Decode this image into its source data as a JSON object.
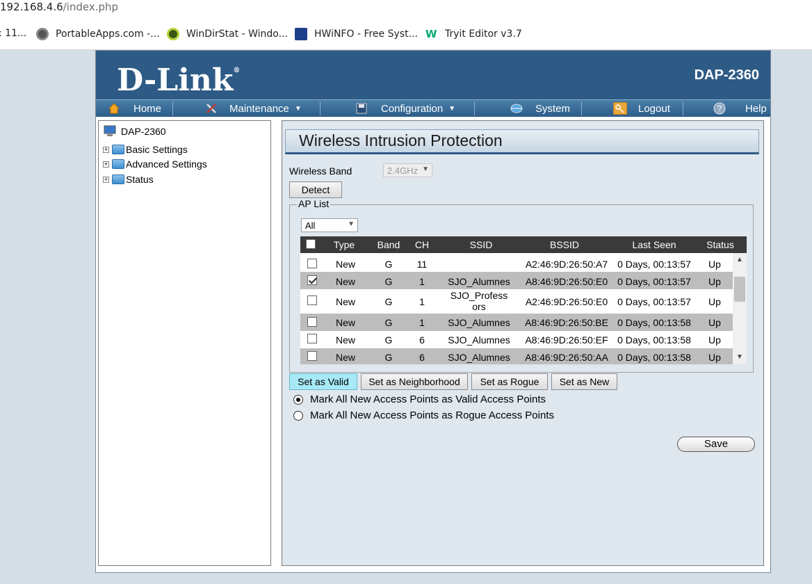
{
  "browser": {
    "url_host": "192.168.4.6",
    "url_path": "/index.php",
    "bookmarks": [
      {
        "label": ": 11...",
        "icon": "page-icon"
      },
      {
        "label": "PortableApps.com -...",
        "icon": "portableapps-icon"
      },
      {
        "label": "WinDirStat - Windo...",
        "icon": "windirstat-icon"
      },
      {
        "label": "HWiNFO - Free Syst...",
        "icon": "hwinfo-icon"
      },
      {
        "label": "Tryit Editor v3.7",
        "icon": "w3schools-icon"
      }
    ]
  },
  "header": {
    "logo": "D-Link",
    "logo_mark": "®",
    "model": "DAP-2360"
  },
  "nav": {
    "home": "Home",
    "maintenance": "Maintenance",
    "configuration": "Configuration",
    "system": "System",
    "logout": "Logout",
    "help": "Help"
  },
  "tree": {
    "root": "DAP-2360",
    "items": [
      "Basic Settings",
      "Advanced Settings",
      "Status"
    ]
  },
  "main": {
    "title": "Wireless Intrusion Protection",
    "wireless_band_label": "Wireless Band",
    "wireless_band_value": "2.4GHz",
    "detect_button": "Detect",
    "ap_list_legend": "AP List",
    "filter_value": "All",
    "columns": [
      "Type",
      "Band",
      "CH",
      "SSID",
      "BSSID",
      "Last Seen",
      "Status"
    ],
    "rows": [
      {
        "checked": false,
        "type": "New",
        "band": "G",
        "ch": "11",
        "ssid": "",
        "bssid": "A2:46:9D:26:50:A7",
        "last_seen": "0 Days, 00:13:57",
        "status": "Up"
      },
      {
        "checked": true,
        "type": "New",
        "band": "G",
        "ch": "1",
        "ssid": "SJO_Alumnes",
        "bssid": "A8:46:9D:26:50:E0",
        "last_seen": "0 Days, 00:13:57",
        "status": "Up"
      },
      {
        "checked": false,
        "type": "New",
        "band": "G",
        "ch": "1",
        "ssid_line1": "SJO_Profess",
        "ssid_line2": "ors",
        "bssid": "A2:46:9D:26:50:E0",
        "last_seen": "0 Days, 00:13:57",
        "status": "Up"
      },
      {
        "checked": false,
        "type": "New",
        "band": "G",
        "ch": "1",
        "ssid": "SJO_Alumnes",
        "bssid": "A8:46:9D:26:50:BE",
        "last_seen": "0 Days, 00:13:58",
        "status": "Up"
      },
      {
        "checked": false,
        "type": "New",
        "band": "G",
        "ch": "6",
        "ssid": "SJO_Alumnes",
        "bssid": "A8:46:9D:26:50:EF",
        "last_seen": "0 Days, 00:13:58",
        "status": "Up"
      },
      {
        "checked": false,
        "type": "New",
        "band": "G",
        "ch": "6",
        "ssid": "SJO_Alumnes",
        "bssid": "A8:46:9D:26:50:AA",
        "last_seen": "0 Days, 00:13:58",
        "status": "Up"
      }
    ],
    "buttons": {
      "valid": "Set as Valid",
      "neighborhood": "Set as Neighborhood",
      "rogue": "Set as Rogue",
      "new": "Set as New"
    },
    "radio_valid": "Mark All New Access Points as Valid Access Points",
    "radio_rogue": "Mark All New Access Points as Rogue Access Points",
    "save": "Save"
  },
  "colors": {
    "header_blue": "#2e5b86",
    "active_button": "#a7e9f6",
    "table_header": "#3a3a3a"
  }
}
